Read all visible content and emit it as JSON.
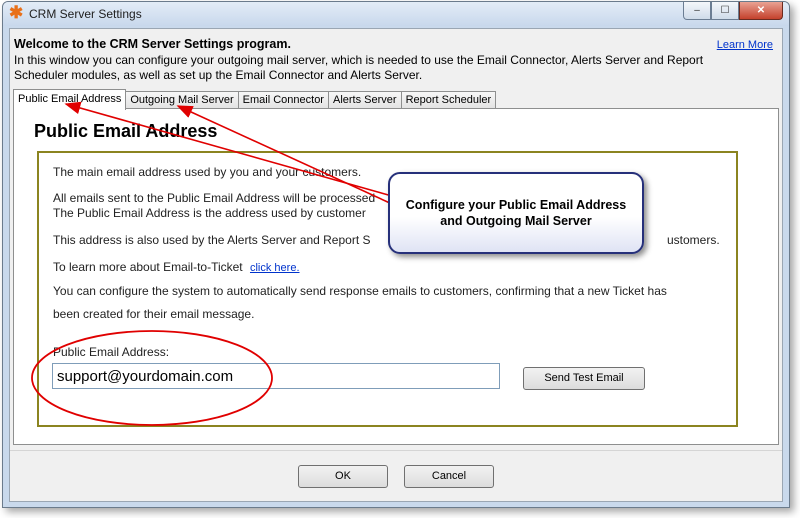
{
  "window": {
    "title": "CRM Server Settings",
    "buttons": {
      "minimize": "–",
      "maximize": "☐",
      "close": "✕"
    }
  },
  "header": {
    "title": "Welcome to the CRM Server Settings program.",
    "text": "In this window you can configure your outgoing mail server, which is needed to use the Email Connector, Alerts Server and Report Scheduler modules, as well as set up the Email Connector and Alerts Server.",
    "learn_more": "Learn More"
  },
  "tabs": [
    {
      "label": "Public Email Address",
      "active": true
    },
    {
      "label": "Outgoing Mail Server",
      "active": false
    },
    {
      "label": "Email Connector",
      "active": false
    },
    {
      "label": "Alerts Server",
      "active": false
    },
    {
      "label": "Report Scheduler",
      "active": false
    }
  ],
  "panel": {
    "heading": "Public Email Address",
    "paragraphs": [
      "The main email address used by you and your customers.",
      "All emails sent to the Public Email Address will be processed",
      "The Public Email Address is the address used by customer",
      "This address is also used by the Alerts Server and Report S",
      "ustomers.",
      "To learn more about Email-to-Ticket",
      "You can configure the system to automatically send response emails to customers, confirming that a new Ticket has",
      "been created for their email message."
    ],
    "link_text": "click here.",
    "field_label": "Public Email Address:",
    "field_value": "support@yourdomain.com",
    "test_button": "Send Test Email"
  },
  "footer": {
    "ok": "OK",
    "cancel": "Cancel"
  },
  "callout": {
    "line1": "Configure your Public Email Address",
    "line2": "and Outgoing Mail Server"
  },
  "colors": {
    "annotation": "#e00000",
    "box_border": "#8b8420",
    "callout_border": "#26307a"
  },
  "icons": {
    "app": "asterisk-icon"
  }
}
